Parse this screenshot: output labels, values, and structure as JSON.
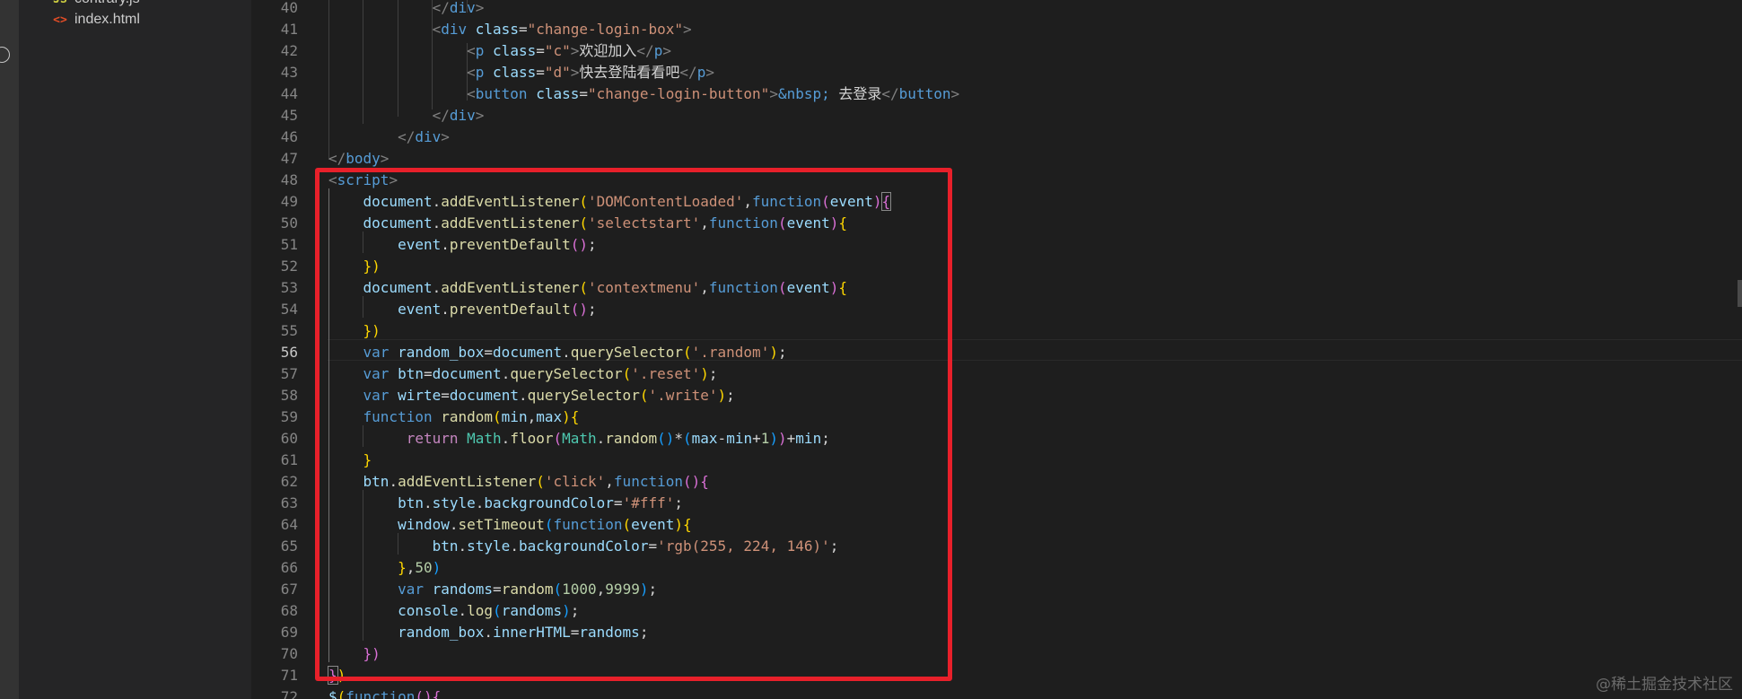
{
  "explorer": {
    "items": [
      {
        "name": "contrary.js",
        "icon": "js-file-icon"
      },
      {
        "name": "index.html",
        "icon": "html-file-icon"
      }
    ]
  },
  "editor": {
    "active_line": 56,
    "line_numbers": [
      "40",
      "41",
      "42",
      "43",
      "44",
      "45",
      "46",
      "47",
      "48",
      "49",
      "50",
      "51",
      "52",
      "53",
      "54",
      "55",
      "56",
      "57",
      "58",
      "59",
      "60",
      "61",
      "62",
      "63",
      "64",
      "65",
      "66",
      "67",
      "68",
      "69",
      "70",
      "71",
      "72"
    ]
  },
  "watermark": "@稀土掘金技术社区",
  "colors": {
    "highlight_box": "#e8202a",
    "background": "#1e1e1e"
  }
}
